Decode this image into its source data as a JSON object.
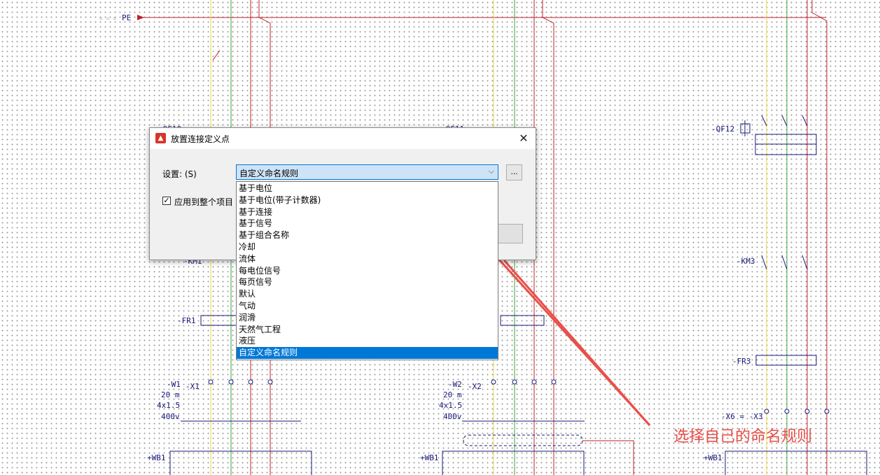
{
  "schematic": {
    "signal_label": "PE",
    "devices": {
      "qf10": "-QF10",
      "qf11": "-QF11",
      "qf12": "-QF12",
      "km1": "-KM1",
      "km3": "-KM3",
      "fr1": "-FR1",
      "fr3": "-FR3",
      "w1": "-W1",
      "w2": "-W2",
      "x1": "-X1",
      "x2": "-X2",
      "x6x3": "-X6 = -X3",
      "wb1": "+WB1"
    },
    "cable_spec": {
      "length": "20 m",
      "size": "4x1.5",
      "voltage": "400v"
    }
  },
  "dialog": {
    "title": "放置连接定义点",
    "icon": "warning-triangle-icon",
    "setting_label": "设置: (S)",
    "combo_value": "自定义命名规则",
    "more_button": "...",
    "apply_checkbox_label": "应用到整个项目",
    "apply_checked": true
  },
  "dropdown": {
    "items": [
      "基于电位",
      "基于电位(带子计数器)",
      "基于连接",
      "基于信号",
      "基于组合名称",
      "冷却",
      "流体",
      "每电位信号",
      "每页信号",
      "默认",
      "气动",
      "润滑",
      "天然气工程",
      "液压",
      "自定义命名规则"
    ],
    "selected_index": 14
  },
  "annotation": {
    "text": "选择自己的命名规则",
    "color": "#e8504a"
  },
  "colors": {
    "wire_red": "#c0202a",
    "wire_yellow": "#e8d44a",
    "wire_green": "#3aa63a",
    "symbol_blue": "#1a1a7a",
    "selection_blue": "#0078d7"
  }
}
